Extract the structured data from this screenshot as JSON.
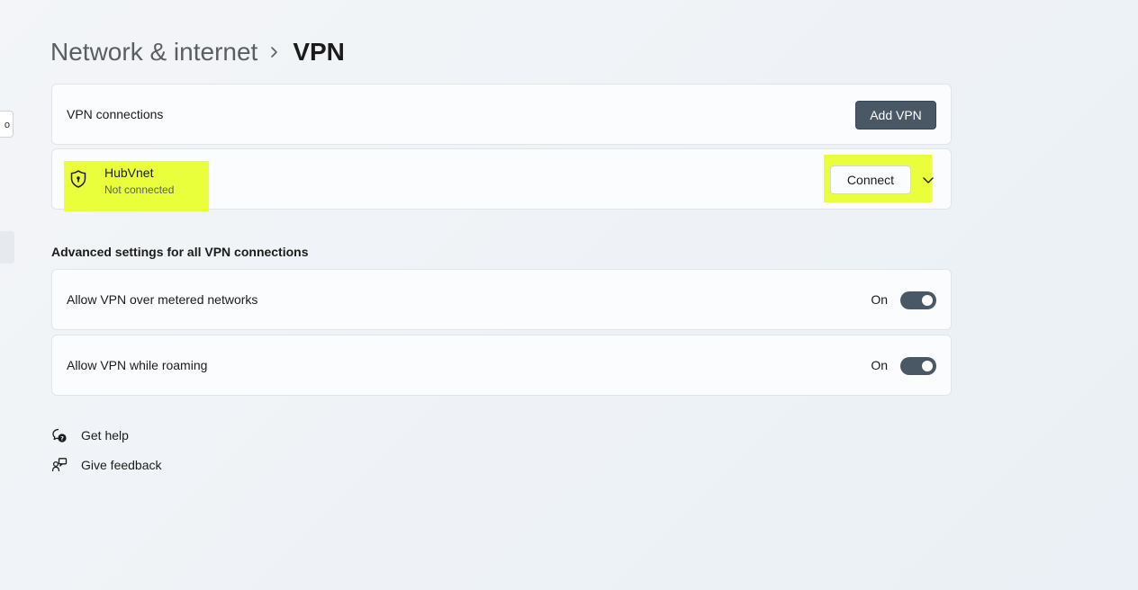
{
  "sidebar": {
    "partial_text": "o"
  },
  "breadcrumb": {
    "parent": "Network & internet",
    "separator_icon": "chevron-right-icon",
    "current": "VPN"
  },
  "vpn_connections": {
    "label": "VPN connections",
    "add_button_label": "Add VPN"
  },
  "vpn_entry": {
    "icon": "shield-lock-icon",
    "name": "HubVnet",
    "status": "Not connected",
    "connect_label": "Connect",
    "expand_icon": "chevron-down-icon"
  },
  "advanced": {
    "heading": "Advanced settings for all VPN connections",
    "items": [
      {
        "label": "Allow VPN over metered networks",
        "state_label": "On",
        "on": true
      },
      {
        "label": "Allow VPN while roaming",
        "state_label": "On",
        "on": true
      }
    ]
  },
  "help_links": {
    "get_help": "Get help",
    "give_feedback": "Give feedback"
  },
  "colors": {
    "accent": "#4a5765",
    "highlight": "#eaff3b",
    "background": "#f3f5f8"
  }
}
